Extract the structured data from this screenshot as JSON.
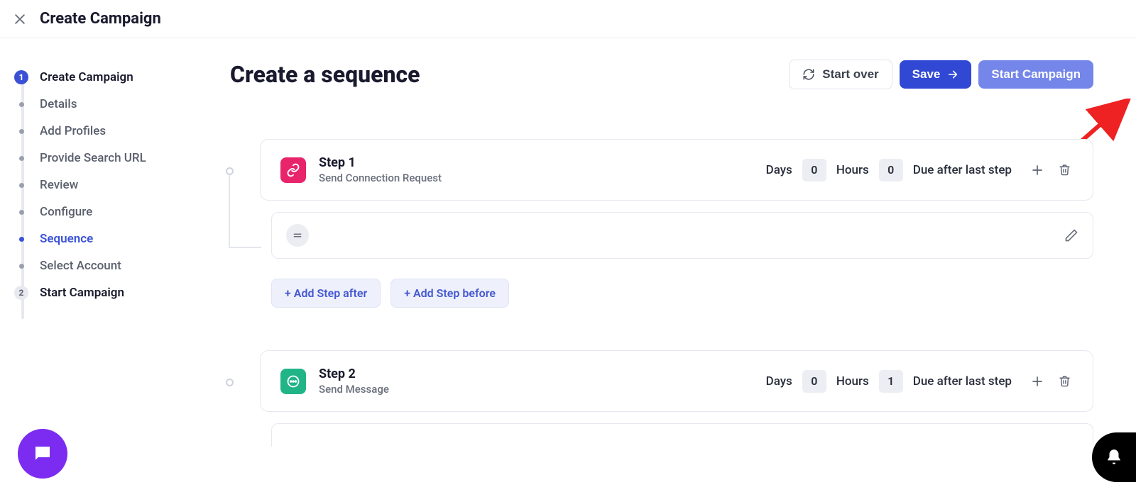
{
  "header": {
    "title": "Create Campaign"
  },
  "main": {
    "title": "Create a sequence"
  },
  "actions": {
    "start_over": "Start over",
    "save": "Save",
    "start_campaign": "Start Campaign"
  },
  "sidebar": {
    "steps": [
      {
        "label": "Create Campaign",
        "bullet": "1"
      },
      {
        "label": "Details"
      },
      {
        "label": "Add Profiles"
      },
      {
        "label": "Provide Search URL"
      },
      {
        "label": "Review"
      },
      {
        "label": "Configure"
      },
      {
        "label": "Sequence"
      },
      {
        "label": "Select Account"
      },
      {
        "label": "Start Campaign",
        "bullet": "2"
      }
    ]
  },
  "sequence": {
    "days_label": "Days",
    "hours_label": "Hours",
    "due_label": "Due after last step",
    "add_after": "+ Add Step after",
    "add_before": "+ Add Step before",
    "steps": [
      {
        "title": "Step 1",
        "subtitle": "Send Connection Request",
        "days": "0",
        "hours": "0"
      },
      {
        "title": "Step 2",
        "subtitle": "Send Message",
        "days": "0",
        "hours": "1"
      }
    ]
  }
}
